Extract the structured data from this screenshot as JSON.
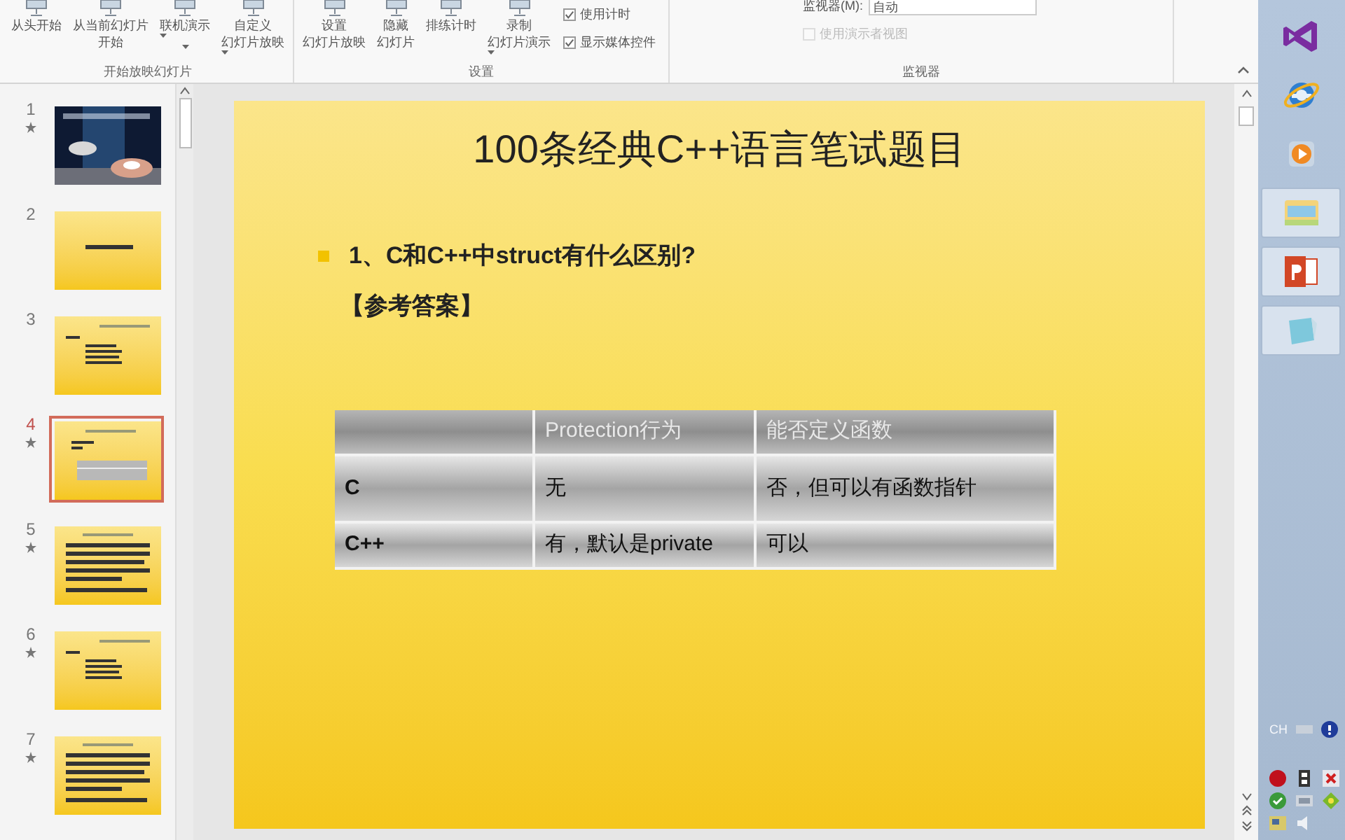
{
  "ribbon": {
    "groups": [
      {
        "label": "开始放映幻灯片",
        "items": [
          {
            "kind": "button",
            "lines": [
              "从头开始"
            ],
            "dropdown": false
          },
          {
            "kind": "button",
            "lines": [
              "从当前幻灯片",
              "开始"
            ],
            "dropdown": false
          },
          {
            "kind": "button",
            "lines": [
              "联机演示"
            ],
            "dropdown": true
          },
          {
            "kind": "button",
            "lines": [
              "自定义",
              "幻灯片放映"
            ],
            "dropdown": true
          }
        ]
      },
      {
        "label": "设置",
        "items": [
          {
            "kind": "button",
            "lines": [
              "设置",
              "幻灯片放映"
            ],
            "dropdown": false
          },
          {
            "kind": "button",
            "lines": [
              "隐藏",
              "幻灯片"
            ],
            "dropdown": false
          },
          {
            "kind": "button",
            "lines": [
              "排练计时"
            ],
            "dropdown": false
          },
          {
            "kind": "button",
            "lines": [
              "录制",
              "幻灯片演示"
            ],
            "dropdown": true
          },
          {
            "kind": "checks",
            "checks": [
              {
                "label": "使用计时",
                "checked": true,
                "disabled": false
              },
              {
                "label": "显示媒体控件",
                "checked": true,
                "disabled": false
              }
            ]
          }
        ]
      },
      {
        "label": "监视器",
        "items": [
          {
            "kind": "monitor",
            "label": "监视器(M):",
            "value": "自动",
            "checks": [
              {
                "label": "使用演示者视图",
                "checked": false,
                "disabled": true
              }
            ]
          }
        ]
      }
    ]
  },
  "thumbnails": [
    {
      "number": "1",
      "animated": true,
      "selected": false,
      "kind": "picture"
    },
    {
      "number": "2",
      "animated": false,
      "selected": false,
      "kind": "title"
    },
    {
      "number": "3",
      "animated": false,
      "selected": false,
      "kind": "list"
    },
    {
      "number": "4",
      "animated": true,
      "selected": true,
      "kind": "table"
    },
    {
      "number": "5",
      "animated": true,
      "selected": false,
      "kind": "text"
    },
    {
      "number": "6",
      "animated": true,
      "selected": false,
      "kind": "list"
    },
    {
      "number": "7",
      "animated": true,
      "selected": false,
      "kind": "text"
    }
  ],
  "slide": {
    "title": "100条经典C++语言笔试题目",
    "bullet": "1、C和C++中struct有什么区别?",
    "answer_label": "【参考答案】",
    "table": {
      "columns": [
        "",
        "Protection行为",
        "能否定义函数"
      ],
      "rows": [
        [
          "C",
          "无",
          "否，但可以有函数指针"
        ],
        [
          "C++",
          "有，默认是private",
          "可以"
        ]
      ]
    }
  },
  "taskbar": {
    "apps": [
      {
        "kind": "vs",
        "selected": false
      },
      {
        "kind": "ie",
        "selected": false
      },
      {
        "kind": "player",
        "selected": false
      },
      {
        "kind": "folder",
        "selected": true
      },
      {
        "kind": "ppt",
        "selected": true
      },
      {
        "kind": "notepad",
        "selected": true
      }
    ],
    "tray": {
      "language": "CH"
    }
  }
}
